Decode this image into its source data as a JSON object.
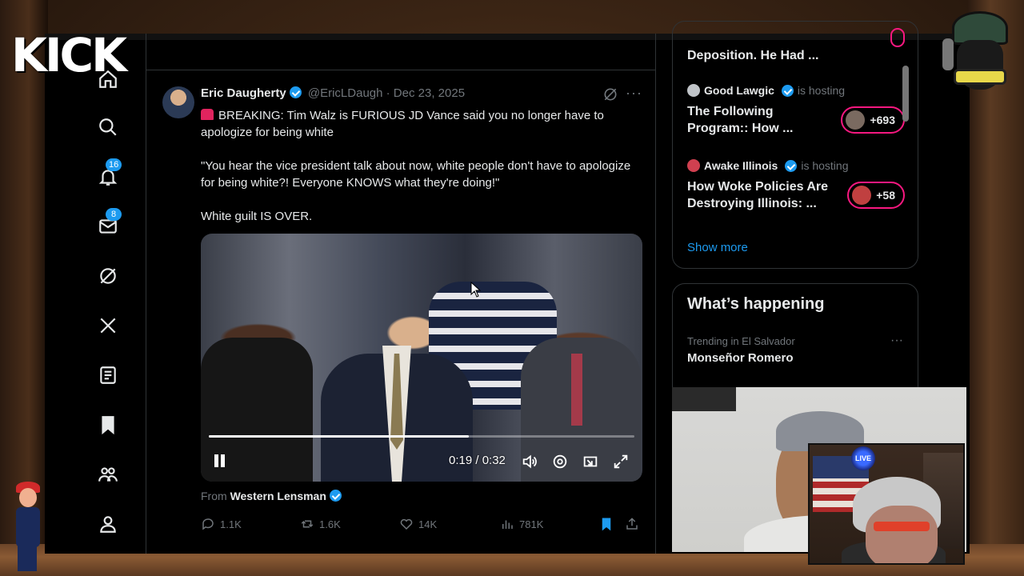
{
  "overlay": {
    "logo_text": "KICK",
    "cam_live_label": "LIVE"
  },
  "nav": {
    "items": [
      {
        "name": "home",
        "icon": "home-icon"
      },
      {
        "name": "explore",
        "icon": "search-icon"
      },
      {
        "name": "notifications",
        "icon": "bell-icon",
        "badge": "16"
      },
      {
        "name": "messages",
        "icon": "mail-icon",
        "badge": "8"
      },
      {
        "name": "grok",
        "icon": "grok-icon"
      },
      {
        "name": "x",
        "icon": "x-logo-icon"
      },
      {
        "name": "lists",
        "icon": "list-icon"
      },
      {
        "name": "bookmarks",
        "icon": "bookmark-icon"
      },
      {
        "name": "communities",
        "icon": "people-icon"
      },
      {
        "name": "profile",
        "icon": "person-icon"
      }
    ]
  },
  "tweet": {
    "author_name": "Eric Daugherty",
    "handle_date": "@EricLDaugh · Dec 23, 2025",
    "text_line1": "BREAKING: Tim Walz is FURIOUS JD Vance said you no longer have to apologize for being white",
    "text_quote": "\"You hear the vice president talk about now, white people don't have to apologize for being white?! Everyone KNOWS what they're doing!\"",
    "text_end": "White guilt IS OVER.",
    "video": {
      "time": "0:19 / 0:32",
      "progress": 0.61
    },
    "from_prefix": "From",
    "from_source": "Western Lensman",
    "stats": {
      "replies": "1.1K",
      "reposts": "1.6K",
      "likes": "14K",
      "views": "781K"
    }
  },
  "spaces": {
    "items": [
      {
        "title": "Deposition. He Had ..."
      },
      {
        "host": "Good Lawgic",
        "status": "is hosting",
        "title": "The Following Program:: How ...",
        "listeners": "+693"
      },
      {
        "host": "Awake Illinois",
        "status": "is hosting",
        "title": "How Woke Policies Are Destroying Illinois:  ...",
        "listeners": "+58"
      }
    ],
    "show_more": "Show more"
  },
  "happening": {
    "title": "What’s happening",
    "trend_context": "Trending in El Salvador",
    "trend_name": "Monseñor Romero"
  },
  "colors": {
    "accent": "#1d9bf0",
    "pill_border": "#f91880",
    "background": "#000000"
  }
}
